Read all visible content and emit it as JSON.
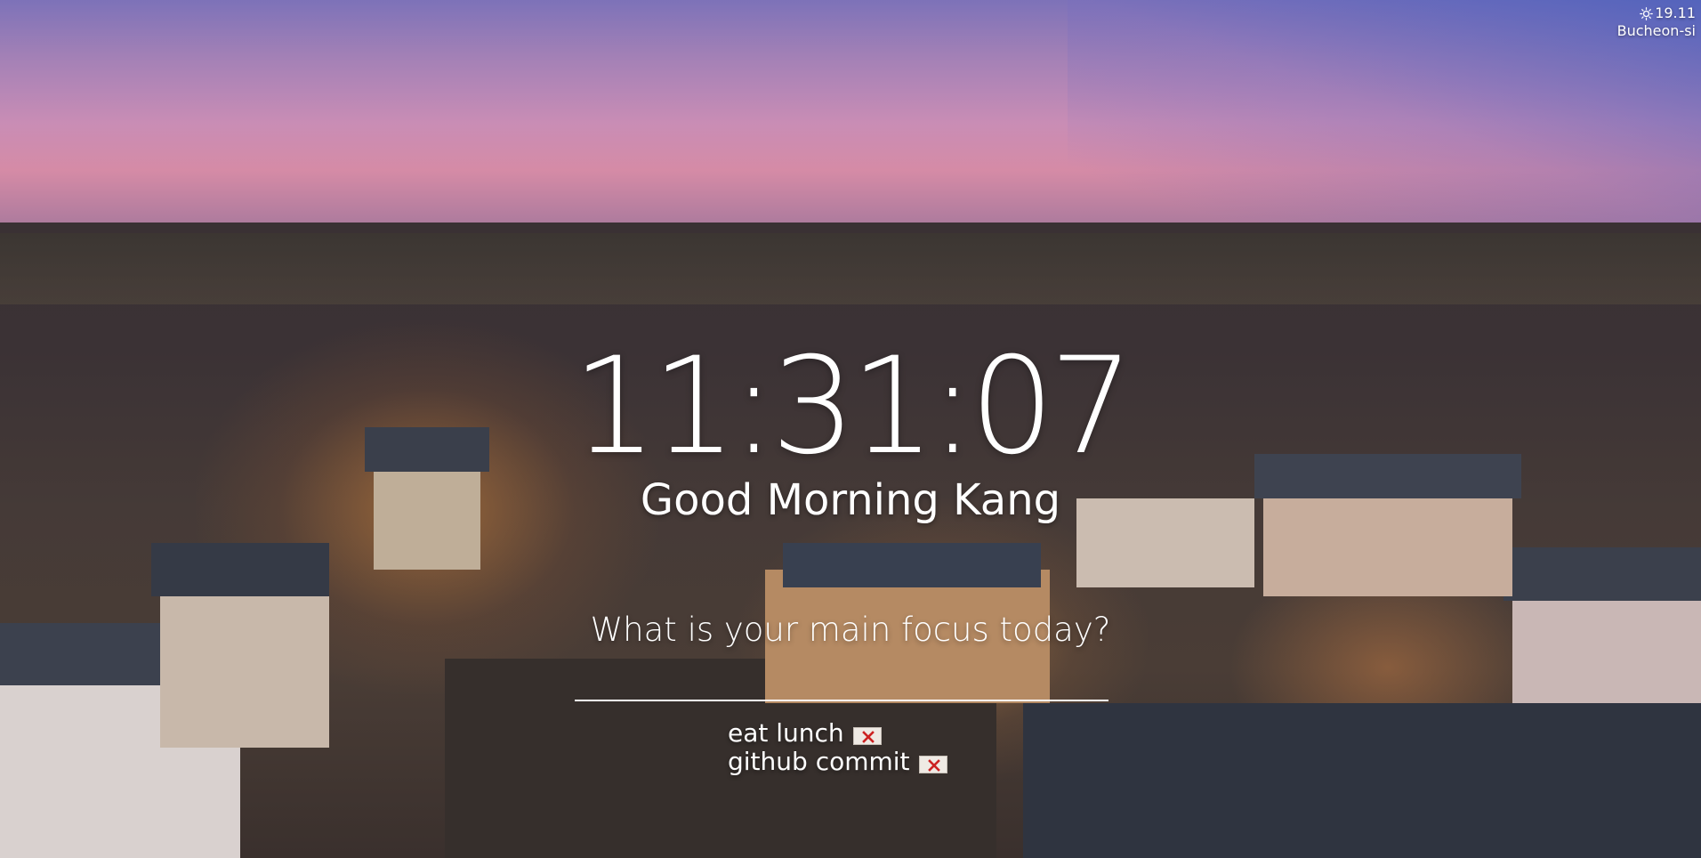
{
  "weather": {
    "icon": "sun-icon",
    "temperature": "19.11",
    "location": "Bucheon-si"
  },
  "clock": {
    "time": "11:31:07"
  },
  "greeting": {
    "text": "Good Morning Kang"
  },
  "focus": {
    "prompt": "What is your main focus today?",
    "value": "",
    "placeholder": ""
  },
  "todos": [
    {
      "label": "eat lunch",
      "delete_icon": "close-icon"
    },
    {
      "label": "github commit",
      "delete_icon": "close-icon"
    }
  ],
  "colors": {
    "text": "#ffffff",
    "delete_icon": "#cc2222"
  }
}
